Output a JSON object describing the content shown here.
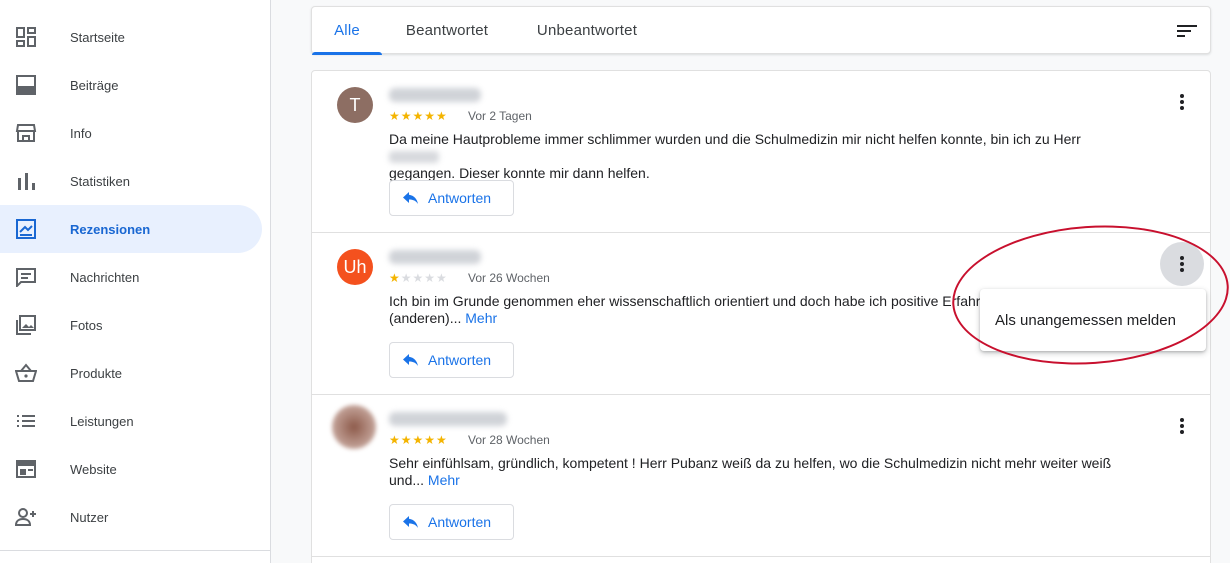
{
  "sidebar": {
    "items": [
      {
        "label": "Startseite",
        "icon": "dashboard-icon"
      },
      {
        "label": "Beiträge",
        "icon": "posts-icon"
      },
      {
        "label": "Info",
        "icon": "storefront-icon"
      },
      {
        "label": "Statistiken",
        "icon": "bar-chart-icon"
      },
      {
        "label": "Rezensionen",
        "icon": "reviews-icon",
        "active": true
      },
      {
        "label": "Nachrichten",
        "icon": "message-icon"
      },
      {
        "label": "Fotos",
        "icon": "photo-icon"
      },
      {
        "label": "Produkte",
        "icon": "basket-icon"
      },
      {
        "label": "Leistungen",
        "icon": "list-icon"
      },
      {
        "label": "Website",
        "icon": "website-icon"
      },
      {
        "label": "Nutzer",
        "icon": "add-user-icon"
      }
    ]
  },
  "tabs": [
    {
      "label": "Alle",
      "active": true
    },
    {
      "label": "Beantwortet"
    },
    {
      "label": "Unbeantwortet"
    }
  ],
  "reviews": [
    {
      "avatar_letter": "T",
      "avatar_color": "#8d6e63",
      "rating": 5,
      "time": "Vor 2 Tagen",
      "text_line1": "Da meine Hautprobleme immer schlimmer wurden und die Schulmedizin mir nicht helfen konnte, bin ich zu Herr",
      "text_line2": "gegangen. Dieser konnte mir dann helfen.",
      "reply_label": "Antworten"
    },
    {
      "avatar_letter": "Uh",
      "avatar_color": "#f4511e",
      "rating": 1,
      "time": "Vor 26 Wochen",
      "text_line1": "Ich bin im Grunde genommen eher wissenschaftlich orientiert und doch habe ich positive Erfahr",
      "text_line2": "(anderen)...",
      "more_label": "Mehr",
      "reply_label": "Antworten"
    },
    {
      "avatar_letter": "",
      "avatar_color": "#a1887f",
      "rating": 5,
      "time": "Vor 28 Wochen",
      "text_line1": "Sehr einfühlsam, gründlich, kompetent ! Herr Pubanz weiß da zu helfen, wo die Schulmedizin nicht mehr weiter weiß",
      "text_line2": "und...",
      "more_label": "Mehr",
      "reply_label": "Antworten"
    }
  ],
  "menu": {
    "report_label": "Als unangemessen melden"
  },
  "colors": {
    "accent": "#1a73e8",
    "star": "#f4b400",
    "annotation": "#c8102e"
  }
}
